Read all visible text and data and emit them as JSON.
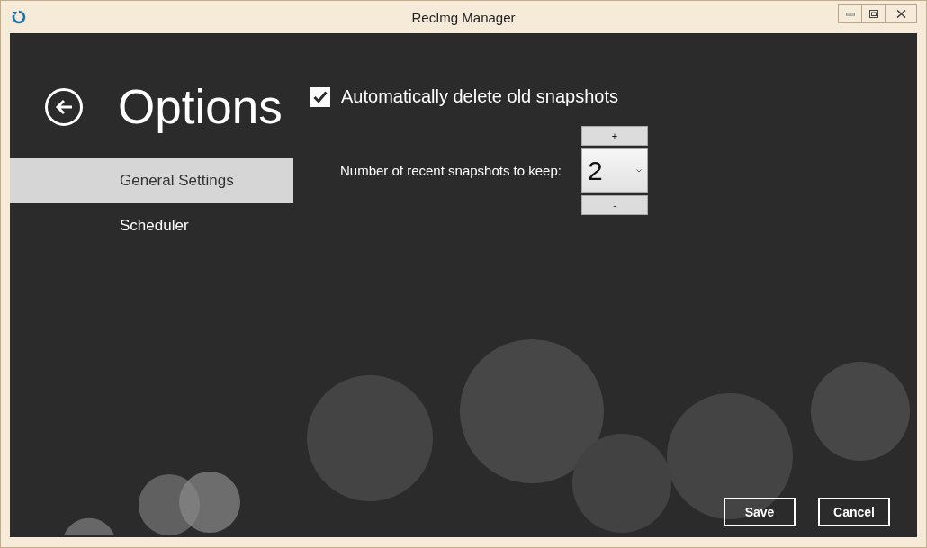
{
  "window": {
    "title": "RecImg Manager"
  },
  "page": {
    "heading": "Options"
  },
  "sidebar": {
    "items": [
      {
        "label": "General Settings",
        "selected": true
      },
      {
        "label": "Scheduler",
        "selected": false
      }
    ]
  },
  "settings": {
    "auto_delete": {
      "label": "Automatically delete old snapshots",
      "checked": true
    },
    "keep_count": {
      "label": "Number of recent snapshots to keep:",
      "value": "2",
      "increment": "+",
      "decrement": "-"
    }
  },
  "buttons": [
    "Save",
    "Cancel"
  ]
}
